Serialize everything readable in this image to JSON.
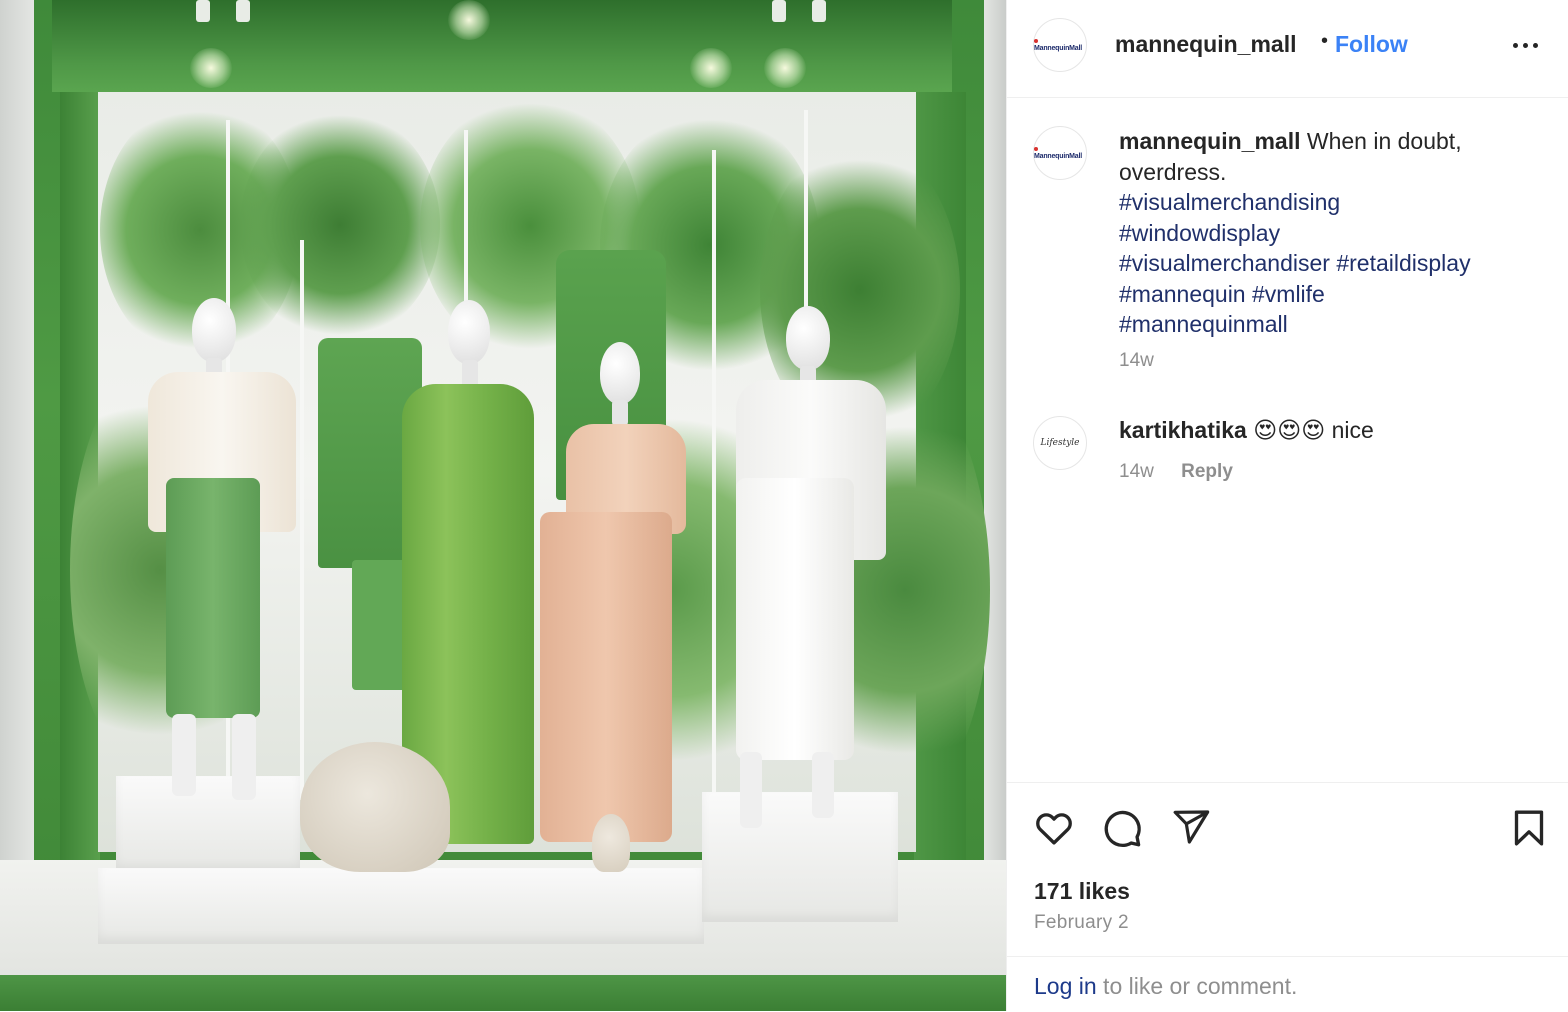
{
  "header": {
    "avatar_label": "MannequinMall",
    "username": "mannequin_mall",
    "separator": "•",
    "follow_label": "Follow",
    "more_icon": "more-horizontal-icon"
  },
  "caption": {
    "username": "mannequin_mall",
    "text": "When in doubt, overdress.",
    "hashtags": [
      "#visualmerchandising",
      "#windowdisplay",
      "#visualmerchandiser",
      "#retaildisplay",
      "#mannequin",
      "#vmlife",
      "#mannequinmall"
    ],
    "time": "14w"
  },
  "comments": [
    {
      "avatar_label": "Lifestyle",
      "username": "kartikhatika",
      "text": "😍😍😍 nice",
      "time": "14w",
      "reply_label": "Reply"
    }
  ],
  "actions": {
    "icons": [
      "heart-icon",
      "comment-icon",
      "share-icon",
      "bookmark-icon"
    ],
    "likes": "171 likes",
    "date": "February 2"
  },
  "login": {
    "link_text": "Log in",
    "rest_text": " to like or comment."
  },
  "colors": {
    "follow": "#3b82f6",
    "hashtag": "#20306a",
    "text": "#262626",
    "secondary": "#8e8e8e",
    "display_green": "#4f9a44"
  }
}
